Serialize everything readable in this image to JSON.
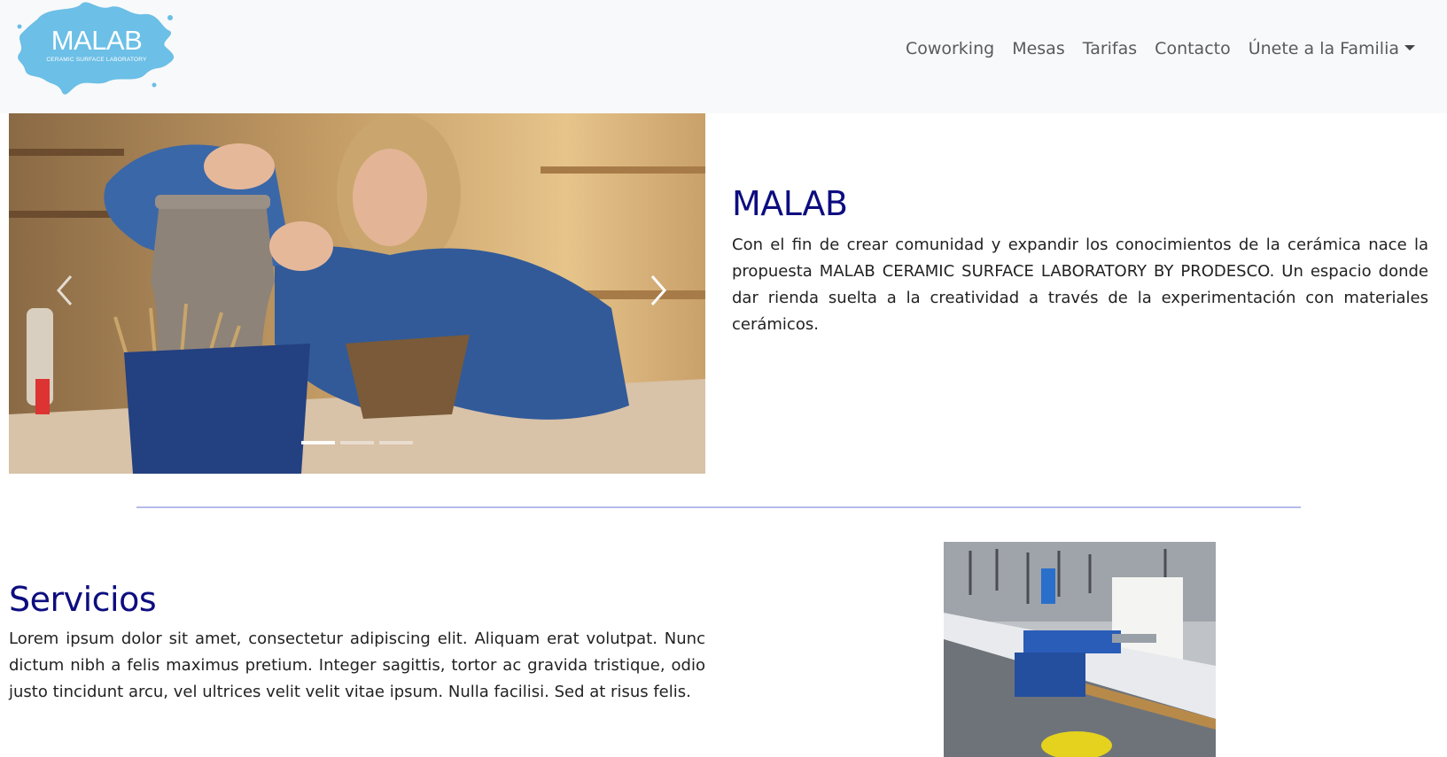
{
  "brand": {
    "name": "MALAB",
    "tagline": "CERAMIC SURFACE LABORATORY",
    "color": "#6cbfe6"
  },
  "nav": {
    "items": [
      {
        "label": "Coworking"
      },
      {
        "label": "Mesas"
      },
      {
        "label": "Tarifas"
      },
      {
        "label": "Contacto"
      },
      {
        "label": "Únete a la Familia"
      }
    ]
  },
  "carousel": {
    "prev_icon": "chevron-left-icon",
    "next_icon": "chevron-right-icon",
    "slide_count": 3,
    "active_slide": 1
  },
  "intro": {
    "title": "MALAB",
    "text": "Con el fin de crear comunidad y expandir los conocimientos de la cerámica nace la propuesta MALAB CERAMIC SURFACE LABORATORY BY PRODESCO. Un espacio donde dar rienda suelta a la creatividad a través de la experimentación con materiales cerámicos."
  },
  "servicios": {
    "title": "Servicios",
    "text": "Lorem ipsum dolor sit amet, consectetur adipiscing elit. Aliquam erat volutpat. Nunc dictum nibh a felis maximus pretium. Integer sagittis, tortor ac gravida tristique, odio justo tincidunt arcu, vel ultrices velit velit vitae ipsum. Nulla facilisi. Sed at risus felis."
  },
  "colors": {
    "heading": "#0d0d80",
    "divider": "#b6bbea",
    "navbar_bg": "#f8f9fa"
  }
}
